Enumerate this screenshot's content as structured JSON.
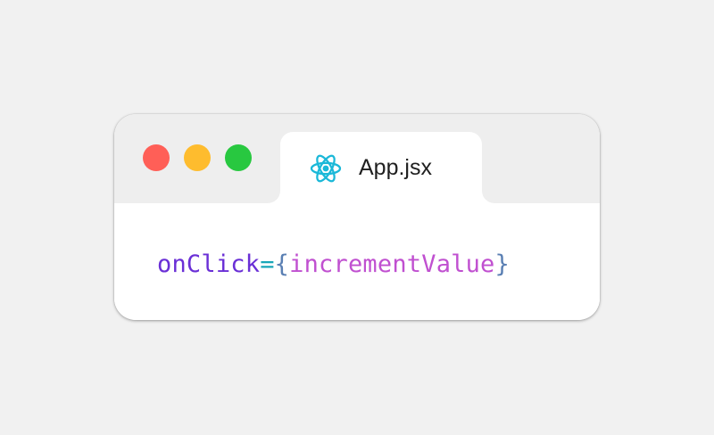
{
  "colors": {
    "background": "#f1f1f1",
    "window": "#ffffff",
    "titlebar": "#eeeeee",
    "dot_red": "#ff5f57",
    "dot_yellow": "#febc2e",
    "dot_green": "#28c840",
    "react": "#1bb8d8",
    "attr": "#6a2fd6",
    "equals": "#17a6b8",
    "brace": "#5a7fb3",
    "identifier": "#c050d0"
  },
  "window": {
    "controls": [
      "close",
      "minimize",
      "maximize"
    ]
  },
  "tab": {
    "icon": "react-icon",
    "filename": "App.jsx"
  },
  "code": {
    "attribute": "onClick",
    "equals": "=",
    "open_brace": "{",
    "identifier": "incrementValue",
    "close_brace": "}"
  }
}
